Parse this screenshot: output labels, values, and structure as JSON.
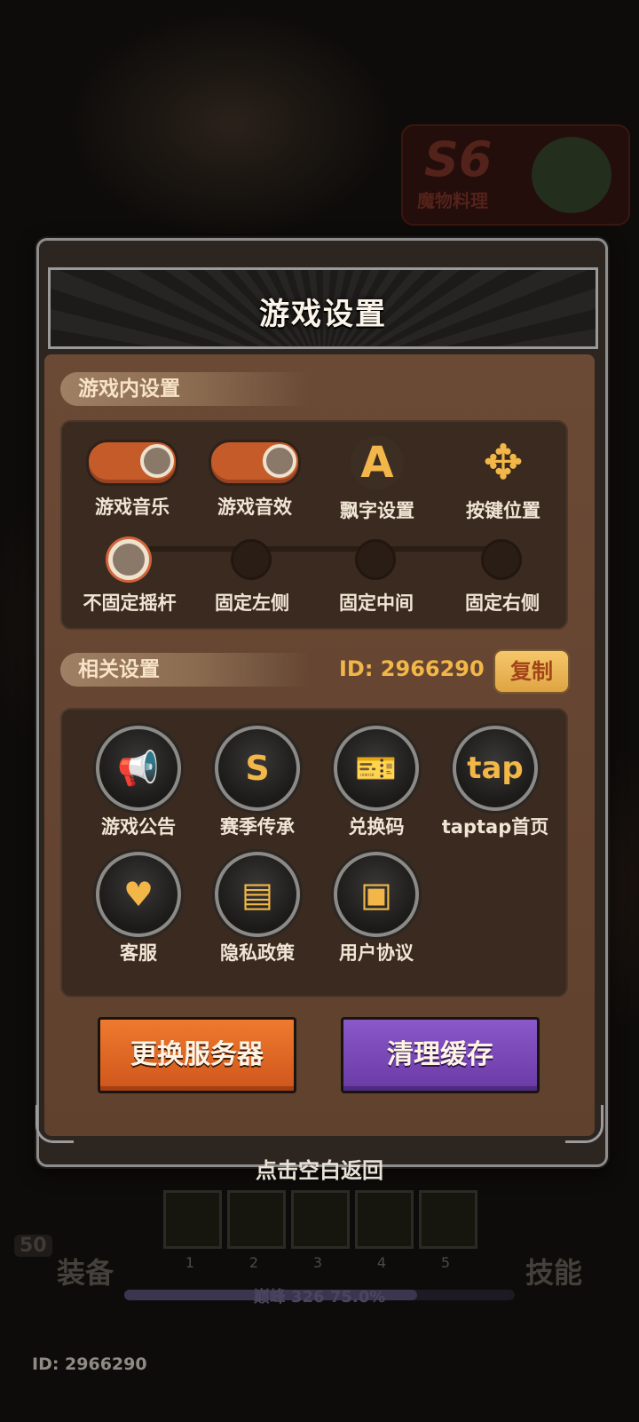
{
  "background": {
    "season_badge": {
      "code": "S6",
      "name": "魔物料理"
    }
  },
  "panel": {
    "title": "游戏设置",
    "ingame_section": {
      "label": "游戏内设置",
      "items": [
        {
          "label": "游戏音乐",
          "type": "toggle",
          "on": true
        },
        {
          "label": "游戏音效",
          "type": "toggle",
          "on": true
        },
        {
          "label": "飘字设置",
          "type": "icon",
          "icon": "font-a-icon"
        },
        {
          "label": "按键位置",
          "type": "icon",
          "icon": "move-arrows-icon"
        }
      ],
      "joystick": {
        "options": [
          "不固定摇杆",
          "固定左侧",
          "固定中间",
          "固定右侧"
        ],
        "selected": "不固定摇杆"
      }
    },
    "related_section": {
      "label": "相关设置",
      "id_text": "ID: 2966290",
      "copy_label": "复制",
      "items": [
        {
          "label": "游戏公告",
          "icon": "megaphone-icon"
        },
        {
          "label": "赛季传承",
          "icon": "season-s-icon"
        },
        {
          "label": "兑换码",
          "icon": "ticket-icon"
        },
        {
          "label": "taptap首页",
          "icon": "taptap-icon",
          "icon_text": "tap"
        },
        {
          "label": "客服",
          "icon": "customer-service-icon"
        },
        {
          "label": "隐私政策",
          "icon": "document-icon"
        },
        {
          "label": "用户协议",
          "icon": "user-card-icon"
        }
      ]
    },
    "buttons": {
      "change_server": "更换服务器",
      "clear_cache": "清理缓存"
    }
  },
  "tap_to_return": "点击空白返回",
  "hud": {
    "equip": "装备",
    "skill": "技能",
    "level": "50",
    "slots": [
      "1",
      "2",
      "3",
      "4",
      "5"
    ],
    "exp_text": "巅峰 326  75.0%",
    "exp_progress": 0.75
  },
  "footer_id": "ID: 2966290",
  "colors": {
    "accent_gold": "#f2b748",
    "toggle_on": "#c65b2a",
    "button_orange": "#e06a24",
    "button_purple": "#7a48b8",
    "panel_body": "#6b4a35"
  }
}
